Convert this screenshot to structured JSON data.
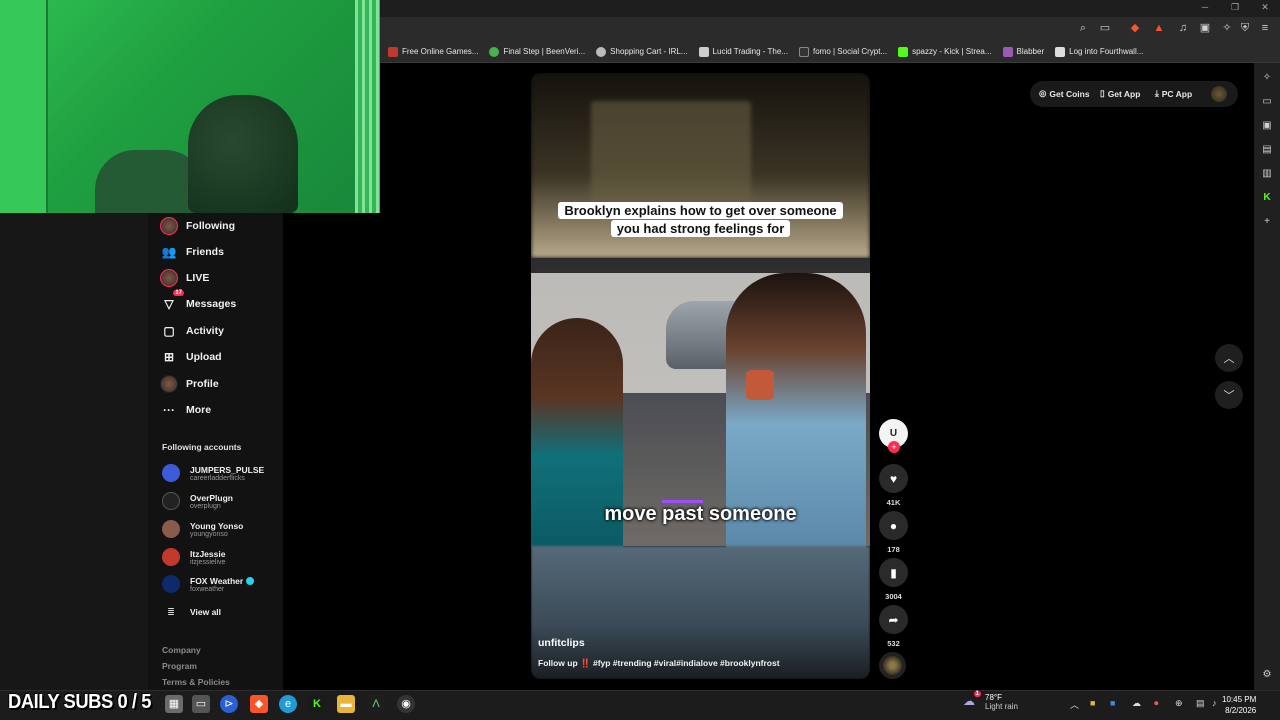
{
  "overlay": {
    "subs_counter": "DAILY SUBS 0 / 5"
  },
  "bookmarks": [
    {
      "label": "Free Online Games...",
      "color": "#c0392b",
      "icon": "game-favicon"
    },
    {
      "label": "Final Step | BeenVeri...",
      "color": "#4caf50",
      "icon": "beenverified-favicon"
    },
    {
      "label": "Shopping Cart - IRL...",
      "color": "#bbbbbb",
      "icon": "globe-favicon"
    },
    {
      "label": "Lucid Trading - The...",
      "color": "#cccccc",
      "icon": "lucid-favicon"
    },
    {
      "label": "fomo | Social Crypt...",
      "color": "#333333",
      "icon": "fomo-favicon"
    },
    {
      "label": "spazzy - Kick | Strea...",
      "color": "#53fc18",
      "icon": "kick-favicon"
    },
    {
      "label": "Blabber",
      "color": "#9b59b6",
      "icon": "blabber-favicon"
    },
    {
      "label": "Log into Fourthwall...",
      "color": "#dddddd",
      "icon": "fourthwall-favicon"
    }
  ],
  "nav": {
    "following": "Following",
    "friends": "Friends",
    "live": "LIVE",
    "messages": "Messages",
    "messages_badge": "17",
    "activity": "Activity",
    "upload": "Upload",
    "profile": "Profile",
    "more": "More"
  },
  "following_accounts": {
    "title": "Following accounts",
    "accounts": [
      {
        "name": "JUMPERS_PULSE",
        "handle": "careerladderflicks",
        "color": "#3b5bdb"
      },
      {
        "name": "OverPlugn",
        "handle": "overplugn",
        "color": "#222222"
      },
      {
        "name": "Young Yonso",
        "handle": "youngyonso",
        "color": "#8a5a4a"
      },
      {
        "name": "ItzJessie",
        "handle": "itzjessielive",
        "color": "#c0392b"
      },
      {
        "name": "FOX Weather",
        "handle": "foxweather",
        "color": "#0d2a6b",
        "verified": true
      }
    ],
    "view_all": "View all"
  },
  "footer": {
    "company": "Company",
    "program": "Program",
    "terms": "Terms & Policies"
  },
  "header": {
    "get_coins": "Get Coins",
    "get_app": "Get App",
    "pc_app": "PC App"
  },
  "video": {
    "caption": "Brooklyn explains how to get over someone you had strong feelings for",
    "subtitle_pre": "move ",
    "subtitle_hl": "past",
    "subtitle_post": " someone",
    "author": "unfitclips",
    "description": "Follow up ‼️ #fyp #trending #viral#indialove #brooklynfrost"
  },
  "actions": {
    "likes": "41K",
    "comments": "178",
    "saves": "3004",
    "shares": "532"
  },
  "taskbar": {
    "weather_temp": "78°F",
    "weather_cond": "Light rain",
    "weather_badge": "1",
    "time": "10:45 PM",
    "date": "8/2/2026"
  },
  "colors": {
    "accent": "#fe2c55",
    "highlight": "#a24cff"
  }
}
